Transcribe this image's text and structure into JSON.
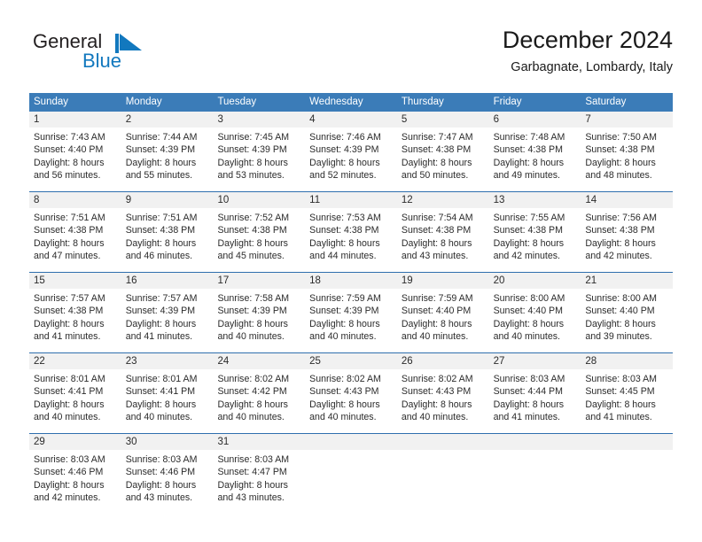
{
  "logo": {
    "word_one": "General",
    "word_two": "Blue",
    "flag_icon": "blue-triangle-flag-icon",
    "blue_hex": "#1278be",
    "dark_hex": "#231f20"
  },
  "header": {
    "title": "December 2024",
    "subtitle": "Garbagnate, Lombardy, Italy"
  },
  "theme": {
    "header_blue": "#3b7cb8",
    "rule_blue": "#2f6fae",
    "daynum_band": "#f1f1f1"
  },
  "weekdays": [
    "Sunday",
    "Monday",
    "Tuesday",
    "Wednesday",
    "Thursday",
    "Friday",
    "Saturday"
  ],
  "weeks": [
    [
      {
        "day": "1",
        "sunrise": "Sunrise: 7:43 AM",
        "sunset": "Sunset: 4:40 PM",
        "daylight_1": "Daylight: 8 hours",
        "daylight_2": "and 56 minutes."
      },
      {
        "day": "2",
        "sunrise": "Sunrise: 7:44 AM",
        "sunset": "Sunset: 4:39 PM",
        "daylight_1": "Daylight: 8 hours",
        "daylight_2": "and 55 minutes."
      },
      {
        "day": "3",
        "sunrise": "Sunrise: 7:45 AM",
        "sunset": "Sunset: 4:39 PM",
        "daylight_1": "Daylight: 8 hours",
        "daylight_2": "and 53 minutes."
      },
      {
        "day": "4",
        "sunrise": "Sunrise: 7:46 AM",
        "sunset": "Sunset: 4:39 PM",
        "daylight_1": "Daylight: 8 hours",
        "daylight_2": "and 52 minutes."
      },
      {
        "day": "5",
        "sunrise": "Sunrise: 7:47 AM",
        "sunset": "Sunset: 4:38 PM",
        "daylight_1": "Daylight: 8 hours",
        "daylight_2": "and 50 minutes."
      },
      {
        "day": "6",
        "sunrise": "Sunrise: 7:48 AM",
        "sunset": "Sunset: 4:38 PM",
        "daylight_1": "Daylight: 8 hours",
        "daylight_2": "and 49 minutes."
      },
      {
        "day": "7",
        "sunrise": "Sunrise: 7:50 AM",
        "sunset": "Sunset: 4:38 PM",
        "daylight_1": "Daylight: 8 hours",
        "daylight_2": "and 48 minutes."
      }
    ],
    [
      {
        "day": "8",
        "sunrise": "Sunrise: 7:51 AM",
        "sunset": "Sunset: 4:38 PM",
        "daylight_1": "Daylight: 8 hours",
        "daylight_2": "and 47 minutes."
      },
      {
        "day": "9",
        "sunrise": "Sunrise: 7:51 AM",
        "sunset": "Sunset: 4:38 PM",
        "daylight_1": "Daylight: 8 hours",
        "daylight_2": "and 46 minutes."
      },
      {
        "day": "10",
        "sunrise": "Sunrise: 7:52 AM",
        "sunset": "Sunset: 4:38 PM",
        "daylight_1": "Daylight: 8 hours",
        "daylight_2": "and 45 minutes."
      },
      {
        "day": "11",
        "sunrise": "Sunrise: 7:53 AM",
        "sunset": "Sunset: 4:38 PM",
        "daylight_1": "Daylight: 8 hours",
        "daylight_2": "and 44 minutes."
      },
      {
        "day": "12",
        "sunrise": "Sunrise: 7:54 AM",
        "sunset": "Sunset: 4:38 PM",
        "daylight_1": "Daylight: 8 hours",
        "daylight_2": "and 43 minutes."
      },
      {
        "day": "13",
        "sunrise": "Sunrise: 7:55 AM",
        "sunset": "Sunset: 4:38 PM",
        "daylight_1": "Daylight: 8 hours",
        "daylight_2": "and 42 minutes."
      },
      {
        "day": "14",
        "sunrise": "Sunrise: 7:56 AM",
        "sunset": "Sunset: 4:38 PM",
        "daylight_1": "Daylight: 8 hours",
        "daylight_2": "and 42 minutes."
      }
    ],
    [
      {
        "day": "15",
        "sunrise": "Sunrise: 7:57 AM",
        "sunset": "Sunset: 4:38 PM",
        "daylight_1": "Daylight: 8 hours",
        "daylight_2": "and 41 minutes."
      },
      {
        "day": "16",
        "sunrise": "Sunrise: 7:57 AM",
        "sunset": "Sunset: 4:39 PM",
        "daylight_1": "Daylight: 8 hours",
        "daylight_2": "and 41 minutes."
      },
      {
        "day": "17",
        "sunrise": "Sunrise: 7:58 AM",
        "sunset": "Sunset: 4:39 PM",
        "daylight_1": "Daylight: 8 hours",
        "daylight_2": "and 40 minutes."
      },
      {
        "day": "18",
        "sunrise": "Sunrise: 7:59 AM",
        "sunset": "Sunset: 4:39 PM",
        "daylight_1": "Daylight: 8 hours",
        "daylight_2": "and 40 minutes."
      },
      {
        "day": "19",
        "sunrise": "Sunrise: 7:59 AM",
        "sunset": "Sunset: 4:40 PM",
        "daylight_1": "Daylight: 8 hours",
        "daylight_2": "and 40 minutes."
      },
      {
        "day": "20",
        "sunrise": "Sunrise: 8:00 AM",
        "sunset": "Sunset: 4:40 PM",
        "daylight_1": "Daylight: 8 hours",
        "daylight_2": "and 40 minutes."
      },
      {
        "day": "21",
        "sunrise": "Sunrise: 8:00 AM",
        "sunset": "Sunset: 4:40 PM",
        "daylight_1": "Daylight: 8 hours",
        "daylight_2": "and 39 minutes."
      }
    ],
    [
      {
        "day": "22",
        "sunrise": "Sunrise: 8:01 AM",
        "sunset": "Sunset: 4:41 PM",
        "daylight_1": "Daylight: 8 hours",
        "daylight_2": "and 40 minutes."
      },
      {
        "day": "23",
        "sunrise": "Sunrise: 8:01 AM",
        "sunset": "Sunset: 4:41 PM",
        "daylight_1": "Daylight: 8 hours",
        "daylight_2": "and 40 minutes."
      },
      {
        "day": "24",
        "sunrise": "Sunrise: 8:02 AM",
        "sunset": "Sunset: 4:42 PM",
        "daylight_1": "Daylight: 8 hours",
        "daylight_2": "and 40 minutes."
      },
      {
        "day": "25",
        "sunrise": "Sunrise: 8:02 AM",
        "sunset": "Sunset: 4:43 PM",
        "daylight_1": "Daylight: 8 hours",
        "daylight_2": "and 40 minutes."
      },
      {
        "day": "26",
        "sunrise": "Sunrise: 8:02 AM",
        "sunset": "Sunset: 4:43 PM",
        "daylight_1": "Daylight: 8 hours",
        "daylight_2": "and 40 minutes."
      },
      {
        "day": "27",
        "sunrise": "Sunrise: 8:03 AM",
        "sunset": "Sunset: 4:44 PM",
        "daylight_1": "Daylight: 8 hours",
        "daylight_2": "and 41 minutes."
      },
      {
        "day": "28",
        "sunrise": "Sunrise: 8:03 AM",
        "sunset": "Sunset: 4:45 PM",
        "daylight_1": "Daylight: 8 hours",
        "daylight_2": "and 41 minutes."
      }
    ],
    [
      {
        "day": "29",
        "sunrise": "Sunrise: 8:03 AM",
        "sunset": "Sunset: 4:46 PM",
        "daylight_1": "Daylight: 8 hours",
        "daylight_2": "and 42 minutes."
      },
      {
        "day": "30",
        "sunrise": "Sunrise: 8:03 AM",
        "sunset": "Sunset: 4:46 PM",
        "daylight_1": "Daylight: 8 hours",
        "daylight_2": "and 43 minutes."
      },
      {
        "day": "31",
        "sunrise": "Sunrise: 8:03 AM",
        "sunset": "Sunset: 4:47 PM",
        "daylight_1": "Daylight: 8 hours",
        "daylight_2": "and 43 minutes."
      },
      {
        "day": "",
        "sunrise": "",
        "sunset": "",
        "daylight_1": "",
        "daylight_2": ""
      },
      {
        "day": "",
        "sunrise": "",
        "sunset": "",
        "daylight_1": "",
        "daylight_2": ""
      },
      {
        "day": "",
        "sunrise": "",
        "sunset": "",
        "daylight_1": "",
        "daylight_2": ""
      },
      {
        "day": "",
        "sunrise": "",
        "sunset": "",
        "daylight_1": "",
        "daylight_2": ""
      }
    ]
  ]
}
